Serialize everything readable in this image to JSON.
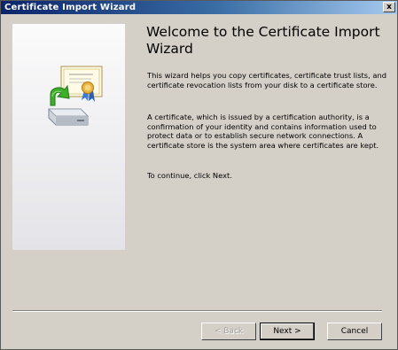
{
  "window": {
    "title": "Certificate Import Wizard",
    "close_glyph": "x"
  },
  "content": {
    "heading": "Welcome to the Certificate Import Wizard",
    "paragraphs": [
      "This wizard helps you copy certificates, certificate trust lists, and certificate revocation lists from your disk to a certificate store.",
      "A certificate, which is issued by a certification authority, is a confirmation of your identity and contains information used to protect data or to establish secure network connections. A certificate store is the system area where certificates are kept.",
      "To continue, click Next."
    ]
  },
  "buttons": {
    "back": "< Back",
    "next": "Next >",
    "cancel": "Cancel"
  },
  "icons": {
    "wizard_icon": "certificate-import-icon"
  }
}
